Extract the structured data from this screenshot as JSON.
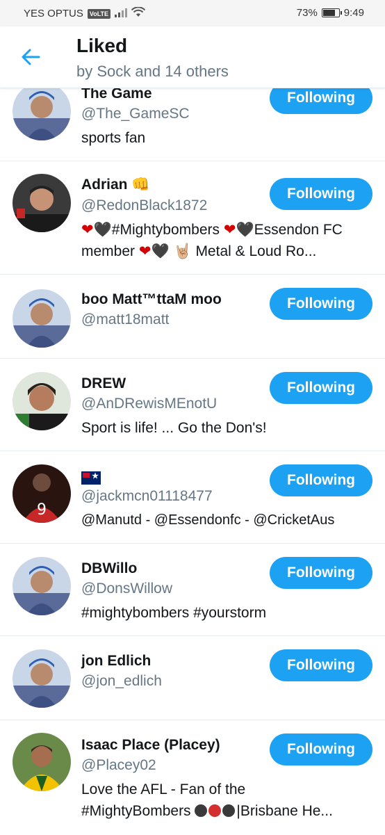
{
  "status": {
    "carrier": "YES OPTUS",
    "volte": "VoLTE",
    "battery_text": "73%",
    "battery_level": 0.73,
    "time": "9:49"
  },
  "header": {
    "title": "Liked",
    "subtitle": "by Sock and 14 others"
  },
  "accent": "#1da1f2",
  "users": [
    {
      "name": "The Game",
      "handle": "@The_GameSC",
      "bio": "sports fan",
      "button": "Following"
    },
    {
      "name": "Adrian 👊",
      "handle": "@RedonBlack1872",
      "bio_parts": [
        "❤",
        "🖤",
        "#Mightybombers  ",
        "❤",
        "🖤",
        "Essendon FC member ",
        "❤",
        "🖤",
        "  🤘🏼 Metal & Loud Ro..."
      ],
      "button": "Following"
    },
    {
      "name": "boo Matt™ttaM moo",
      "handle": "@matt18matt",
      "bio": "",
      "button": "Following"
    },
    {
      "name": "DREW",
      "handle": "@AnDRewisMEnotU",
      "bio": "Sport is life! ... Go the Don's!",
      "button": "Following"
    },
    {
      "name": "",
      "flag": "australia-flag",
      "handle": "@jackmcn01118477",
      "bio": "@Manutd - @Essendonfc - @CricketAus",
      "button": "Following"
    },
    {
      "name": "DBWillo",
      "handle": "@DonsWillow",
      "bio": "#mightybombers #yourstorm",
      "button": "Following"
    },
    {
      "name": "jon Edlich",
      "handle": "@jon_edlich",
      "bio": "",
      "button": "Following"
    },
    {
      "name": "Isaac Place (Placey)",
      "handle": "@Placey02",
      "bio_line1": "Love the AFL - Fan of the",
      "bio_line2_a": "#MightyBombers ",
      "bio_line2_b": "|Brisbane He...",
      "button": "Following"
    }
  ]
}
